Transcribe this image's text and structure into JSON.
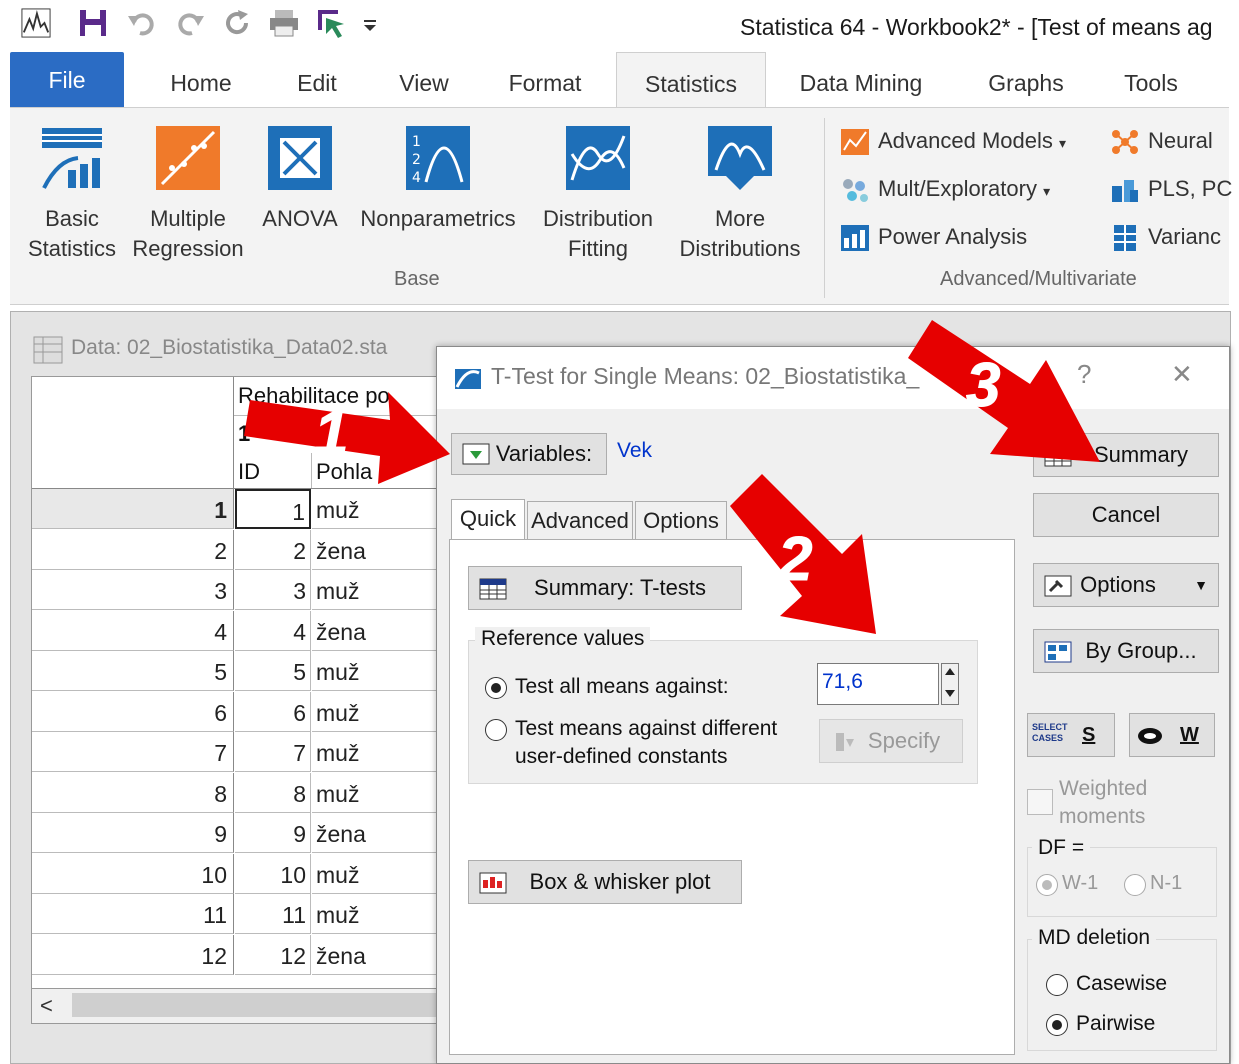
{
  "window": {
    "title": "Statistica 64 - Workbook2* - [Test of means ag"
  },
  "ribbon": {
    "tabs": [
      "File",
      "Home",
      "Edit",
      "View",
      "Format",
      "Statistics",
      "Data Mining",
      "Graphs",
      "Tools"
    ],
    "active_tab": "Statistics",
    "base_buttons": [
      {
        "line1": "Basic",
        "line2": "Statistics"
      },
      {
        "line1": "Multiple",
        "line2": "Regression"
      },
      {
        "line1": "ANOVA",
        "line2": ""
      },
      {
        "line1": "Nonparametrics",
        "line2": ""
      },
      {
        "line1": "Distribution",
        "line2": "Fitting"
      },
      {
        "line1": "More",
        "line2": "Distributions"
      }
    ],
    "base_group_label": "Base",
    "adv_items": [
      "Advanced Models",
      "Mult/Exploratory",
      "Power Analysis"
    ],
    "adv_items2": [
      "Neural",
      "PLS, PC",
      "Varianc"
    ],
    "adv_group_label": "Advanced/Multivariate"
  },
  "data_window": {
    "title": "Data: 02_Biostatistika_Data02.sta",
    "header_var": "Rehabilitace po",
    "header_num": "1",
    "col_id": "ID",
    "col_sex": "Pohla",
    "rows": [
      {
        "n": "1",
        "id": "1",
        "sex": "muž"
      },
      {
        "n": "2",
        "id": "2",
        "sex": "žena"
      },
      {
        "n": "3",
        "id": "3",
        "sex": "muž"
      },
      {
        "n": "4",
        "id": "4",
        "sex": "žena"
      },
      {
        "n": "5",
        "id": "5",
        "sex": "muž"
      },
      {
        "n": "6",
        "id": "6",
        "sex": "muž"
      },
      {
        "n": "7",
        "id": "7",
        "sex": "muž"
      },
      {
        "n": "8",
        "id": "8",
        "sex": "muž"
      },
      {
        "n": "9",
        "id": "9",
        "sex": "žena"
      },
      {
        "n": "10",
        "id": "10",
        "sex": "muž"
      },
      {
        "n": "11",
        "id": "11",
        "sex": "muž"
      },
      {
        "n": "12",
        "id": "12",
        "sex": "žena"
      }
    ],
    "scroll_left": "<"
  },
  "dialog": {
    "title": "T-Test for Single Means: 02_Biostatistika_",
    "help": "?",
    "close": "✕",
    "variables_label": "Variables:",
    "variables_value": "Vek",
    "tabs": [
      "Quick",
      "Advanced",
      "Options"
    ],
    "summary_ttests": "Summary: T-tests",
    "reference_values": "Reference values",
    "radio_all": "Test all means against:",
    "radio_diff_line1": "Test means against different",
    "radio_diff_line2": "user-defined constants",
    "test_value": "71,6",
    "specify": "Specify",
    "box_whisker": "Box & whisker plot",
    "summary": "Summary",
    "cancel": "Cancel",
    "options": "Options",
    "by_group": "By Group...",
    "select_cases_icon_text": "SELECT CASES",
    "s_btn": "S",
    "w_btn": "W",
    "weighted_line1": "Weighted",
    "weighted_line2": "moments",
    "df_label": "DF =",
    "df_w1": "W-1",
    "df_n1": "N-1",
    "md_deletion": "MD deletion",
    "casewise": "Casewise",
    "pairwise": "Pairwise"
  },
  "annotations": [
    "1",
    "2",
    "3"
  ],
  "colors": {
    "file_tab": "#2b6cc4",
    "arrow": "#e60000",
    "link_blue": "#0033cc"
  }
}
